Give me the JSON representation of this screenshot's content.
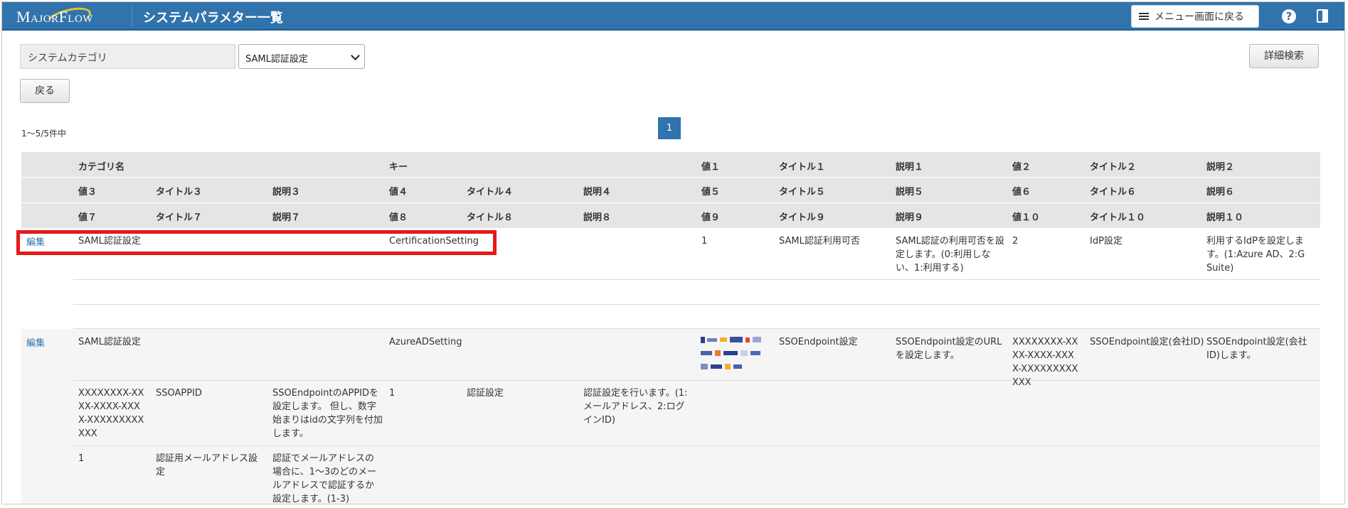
{
  "header": {
    "logo_text": "MajorFlow",
    "title": "システムパラメター一覧",
    "menu_button": "メニュー画面に戻る",
    "help_icon": "?"
  },
  "filter": {
    "category_label": "システムカテゴリ",
    "category_value": "SAML認証設定",
    "detail_search": "詳細検索",
    "back": "戻る"
  },
  "pagination": {
    "count_text": "1～5/5件中",
    "current_page": "1"
  },
  "table": {
    "header_rows": [
      [
        "カテゴリ名",
        "キー",
        "値１",
        "タイトル１",
        "説明１",
        "値２",
        "タイトル２",
        "説明２"
      ],
      [
        "値３",
        "タイトル３",
        "説明３",
        "値４",
        "タイトル４",
        "説明４",
        "値５",
        "タイトル５",
        "説明５",
        "値６",
        "タイトル６",
        "説明６"
      ],
      [
        "値７",
        "タイトル７",
        "説明７",
        "値８",
        "タイトル８",
        "説明８",
        "値９",
        "タイトル９",
        "説明９",
        "値１０",
        "タイトル１０",
        "説明１０"
      ]
    ],
    "edit_label": "編集",
    "records": [
      {
        "category": "SAML認証設定",
        "key": "CertificationSetting",
        "v1": "1",
        "t1": "SAML認証利用可否",
        "d1": "SAML認証の利用可否を設定します。(0:利用しない、1:利用する)",
        "v2": "2",
        "t2": "IdP設定",
        "d2": "利用するIdPを設定します。(1:Azure AD、2:G Suite)"
      },
      {
        "category": "SAML認証設定",
        "key": "AzureADSetting",
        "t1": "SSOEndpoint設定",
        "d1": "SSOEndpoint設定のURLを設定します。",
        "v2": "XXXXXXXX-XXXX-XXXX-XXXX-XXXXXXXXXXXX",
        "t2": "SSOEndpoint設定(会社ID)",
        "d2": "SSOEndpoint設定(会社ID)します。",
        "v3": "XXXXXXXX-XXXX-XXXX-XXXX-XXXXXXXXXXXX",
        "t3": "SSOAPPID",
        "d3": "SSOEndpointのAPPIDを設定します。 但し、数字始まりはidの文字列を付加します。",
        "v4": "1",
        "t4": "認証設定",
        "d4": "認証設定を行います。(1:メールアドレス、2:ログインID)",
        "v7": "1",
        "t7": "認証用メールアドレス設定",
        "d7": "認証でメールアドレスの場合に、1～3のどのメールアドレスで認証するか設定します。(1-3)"
      }
    ]
  },
  "colors": {
    "header_bg": "#3173ac",
    "link": "#3173ac",
    "highlight": "#e41a1a"
  }
}
